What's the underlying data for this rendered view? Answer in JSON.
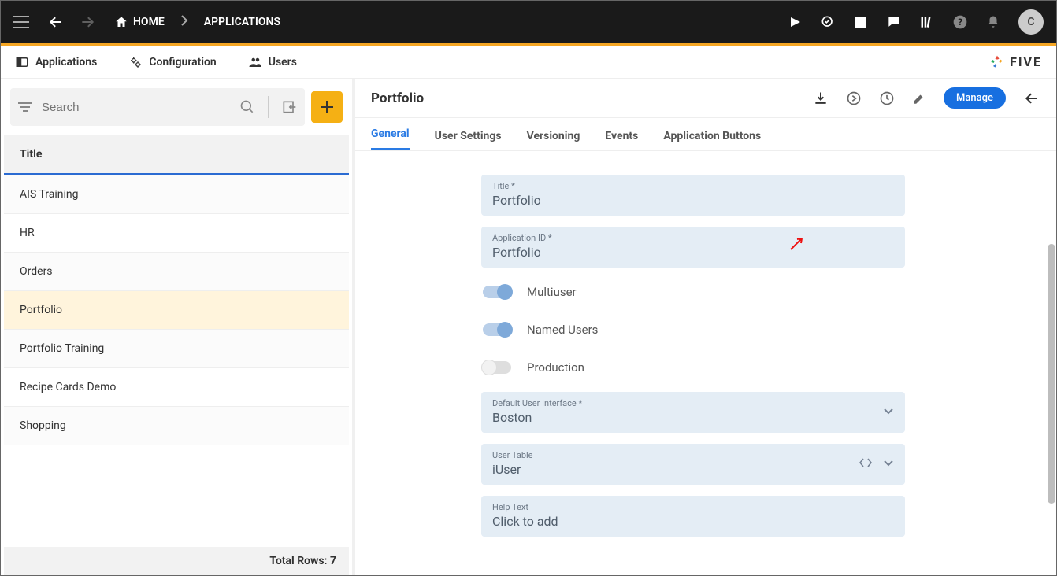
{
  "topbar": {
    "home": "HOME",
    "crumb2": "APPLICATIONS",
    "avatar_letter": "C"
  },
  "maintabs": {
    "applications": "Applications",
    "configuration": "Configuration",
    "users": "Users",
    "brand": "FIVE"
  },
  "left": {
    "search_placeholder": "Search",
    "header": "Title",
    "items": [
      "AIS Training",
      "HR",
      "Orders",
      "Portfolio",
      "Portfolio Training",
      "Recipe Cards Demo",
      "Shopping"
    ],
    "selected_index": 3,
    "total_label": "Total Rows: 7"
  },
  "detail": {
    "title": "Portfolio",
    "manage": "Manage",
    "tabs": [
      "General",
      "User Settings",
      "Versioning",
      "Events",
      "Application Buttons"
    ],
    "active_tab": 0,
    "fields": {
      "title_label": "Title *",
      "title_value": "Portfolio",
      "appid_label": "Application ID *",
      "appid_value": "Portfolio",
      "multiuser_label": "Multiuser",
      "named_label": "Named Users",
      "production_label": "Production",
      "dui_label": "Default User Interface *",
      "dui_value": "Boston",
      "utable_label": "User Table",
      "utable_value": "iUser",
      "help_label": "Help Text",
      "help_value": "Click to add"
    }
  }
}
